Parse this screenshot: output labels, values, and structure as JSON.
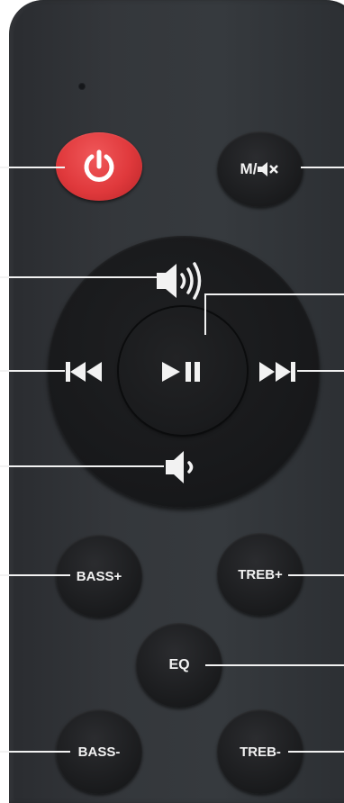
{
  "buttons": {
    "mute_label": "M/",
    "bass_plus": "BASS+",
    "treble_plus": "TREB+",
    "eq": "EQ",
    "bass_minus": "BASS-",
    "treble_minus": "TREB-"
  },
  "icons": {
    "power": "power-icon",
    "mute": "speaker-mute-icon",
    "volume_up": "volume-up-icon",
    "volume_down": "volume-down-icon",
    "previous": "skip-previous-icon",
    "next": "skip-next-icon",
    "play_pause": "play-pause-icon"
  },
  "colors": {
    "remote_body": "#33363a",
    "button": "#1c1d1f",
    "power_button": "#e0393c",
    "label": "#f2f2f2",
    "callout_line": "#f2f2f2"
  }
}
